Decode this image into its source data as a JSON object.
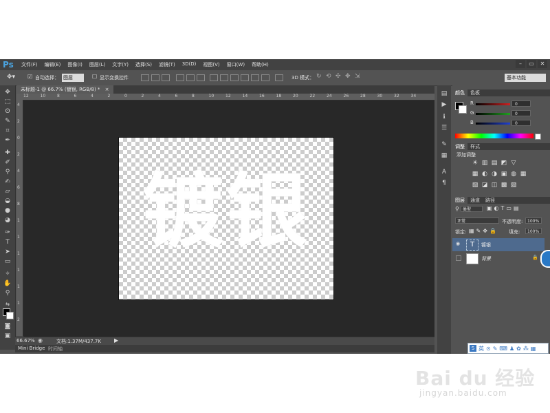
{
  "app": {
    "logo": "Ps",
    "menus": [
      "文件(F)",
      "编辑(E)",
      "图像(I)",
      "图层(L)",
      "文字(Y)",
      "选择(S)",
      "滤镜(T)",
      "3D(D)",
      "视图(V)",
      "窗口(W)",
      "帮助(H)"
    ],
    "window_controls": [
      "–",
      "▭",
      "✕"
    ]
  },
  "options_bar": {
    "auto_select_label": "自动选择：",
    "auto_select_mode": "图层",
    "show_transform_label": "显示变换控件",
    "mode_3d_label": "3D 模式：",
    "workspace": "基本功能"
  },
  "document": {
    "tab_title": "未标题-1 @ 66.7% (镀银, RGB/8) *",
    "tab_close": "×",
    "text": "镀银",
    "zoom": "66.67%",
    "doc_info": "文档:1.37M/437.7K"
  },
  "rulers": {
    "top": [
      "12",
      "10",
      "8",
      "6",
      "4",
      "2",
      "0",
      "2",
      "4",
      "6",
      "8",
      "10",
      "12",
      "14",
      "16",
      "18",
      "20",
      "22",
      "24",
      "26",
      "28",
      "30",
      "32",
      "34"
    ],
    "left": [
      "4",
      "2",
      "0",
      "2",
      "4",
      "6",
      "8",
      "1",
      "1",
      "1",
      "1",
      "1",
      "1",
      "2"
    ]
  },
  "bottom_tabs": [
    "Mini Bridge",
    "时间轴"
  ],
  "color_panel": {
    "tabs": [
      "颜色",
      "色板"
    ],
    "channels": [
      {
        "label": "R",
        "value": "0",
        "color": "#d02020"
      },
      {
        "label": "G",
        "value": "0",
        "color": "#20a020"
      },
      {
        "label": "B",
        "value": "0",
        "color": "#2040d0"
      }
    ]
  },
  "adjust_panel": {
    "tabs": [
      "调整",
      "样式"
    ],
    "heading": "添加调整",
    "row1": [
      "☀",
      "▥",
      "▤",
      "◩",
      "▽"
    ],
    "row2": [
      "▦",
      "◐",
      "◑",
      "▣",
      "◍",
      "▦"
    ],
    "row3": [
      "▨",
      "◪",
      "◫",
      "▩",
      "▧"
    ]
  },
  "layers_panel": {
    "tabs": [
      "图层",
      "通道",
      "路径"
    ],
    "filter": "类型",
    "blend_mode": "正常",
    "opacity_label": "不透明度:",
    "opacity": "100%",
    "lock_label": "锁定:",
    "fill_label": "填充:",
    "fill": "100%",
    "layers": [
      {
        "name": "镀银",
        "kind": "T",
        "selected": true
      },
      {
        "name": "背景",
        "kind": "bg",
        "selected": false
      }
    ]
  },
  "ime": {
    "badge": "S",
    "lang": "英",
    "icons": [
      "⊙",
      "✎",
      "⌨",
      "♟",
      "✿",
      "⁂",
      "▦"
    ]
  },
  "watermark": {
    "logo": "Bai du 经验",
    "url": "jingyan.baidu.com"
  }
}
